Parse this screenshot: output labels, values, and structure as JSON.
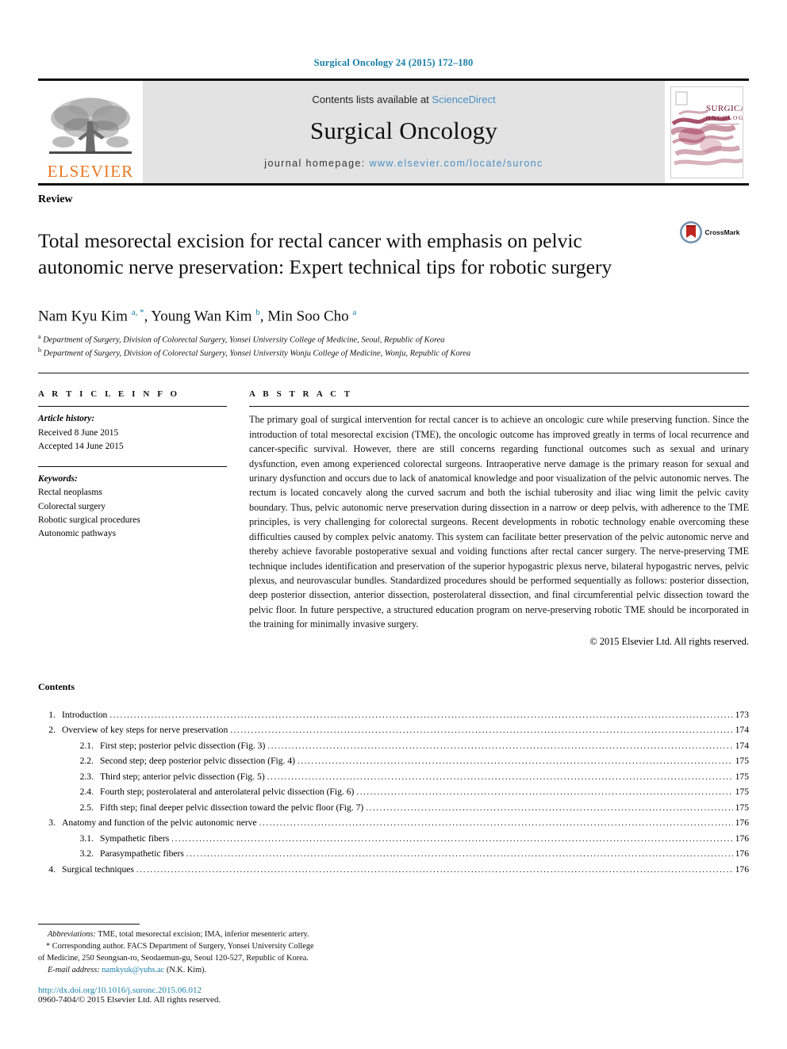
{
  "running_head": "Surgical Oncology 24 (2015) 172–180",
  "masthead": {
    "publisher_wordmark": "ELSEVIER",
    "contents_prefix": "Contents lists available at ",
    "contents_link": "ScienceDirect",
    "journal_name": "Surgical Oncology",
    "homepage_label": "journal homepage: ",
    "homepage_url": "www.elsevier.com/locate/suronc",
    "cover_title_line1": "SURGICAL",
    "cover_title_line2": "ONCOLOGY"
  },
  "article": {
    "section_type": "Review",
    "title": "Total mesorectal excision for rectal cancer with emphasis on pelvic autonomic nerve preservation: Expert technical tips for robotic surgery",
    "crossmark_label": "CrossMark",
    "authors_html": "Nam Kyu Kim <sup>a, *</sup>, Young Wan Kim <sup>b</sup>, Min Soo Cho <sup>a</sup>",
    "affiliations": [
      "Department of Surgery, Division of Colorectal Surgery, Yonsei University College of Medicine, Seoul, Republic of Korea",
      "Department of Surgery, Division of Colorectal Surgery, Yonsei University Wonju College of Medicine, Wonju, Republic of Korea"
    ],
    "affiliation_marks": [
      "a",
      "b"
    ]
  },
  "article_info": {
    "heading": "A R T I C L E  I N F O",
    "history_label": "Article history:",
    "history": [
      "Received 8 June 2015",
      "Accepted 14 June 2015"
    ],
    "keywords_label": "Keywords:",
    "keywords": [
      "Rectal neoplasms",
      "Colorectal surgery",
      "Robotic surgical procedures",
      "Autonomic pathways"
    ]
  },
  "abstract": {
    "heading": "A B S T R A C T",
    "body": "The primary goal of surgical intervention for rectal cancer is to achieve an oncologic cure while preserving function. Since the introduction of total mesorectal excision (TME), the oncologic outcome has improved greatly in terms of local recurrence and cancer-specific survival. However, there are still concerns regarding functional outcomes such as sexual and urinary dysfunction, even among experienced colorectal surgeons. Intraoperative nerve damage is the primary reason for sexual and urinary dysfunction and occurs due to lack of anatomical knowledge and poor visualization of the pelvic autonomic nerves. The rectum is located concavely along the curved sacrum and both the ischial tuberosity and iliac wing limit the pelvic cavity boundary. Thus, pelvic autonomic nerve preservation during dissection in a narrow or deep pelvis, with adherence to the TME principles, is very challenging for colorectal surgeons. Recent developments in robotic technology enable overcoming these difficulties caused by complex pelvic anatomy. This system can facilitate better preservation of the pelvic autonomic nerve and thereby achieve favorable postoperative sexual and voiding functions after rectal cancer surgery. The nerve-preserving TME technique includes identification and preservation of the superior hypogastric plexus nerve, bilateral hypogastric nerves, pelvic plexus, and neurovascular bundles. Standardized procedures should be performed sequentially as follows: posterior dissection, deep posterior dissection, anterior dissection, posterolateral dissection, and final circumferential pelvic dissection toward the pelvic floor. In future perspective, a structured education program on nerve-preserving robotic TME should be incorporated in the training for minimally invasive surgery.",
    "copyright": "© 2015 Elsevier Ltd. All rights reserved."
  },
  "contents": {
    "heading": "Contents",
    "entries": [
      {
        "level": 1,
        "num": "1.",
        "label": "Introduction",
        "page": "173"
      },
      {
        "level": 1,
        "num": "2.",
        "label": "Overview of key steps for nerve preservation",
        "page": "174"
      },
      {
        "level": 2,
        "num": "2.1.",
        "label": "First step; posterior pelvic dissection (Fig. 3)",
        "page": "174"
      },
      {
        "level": 2,
        "num": "2.2.",
        "label": "Second step; deep posterior pelvic dissection (Fig. 4)",
        "page": "175"
      },
      {
        "level": 2,
        "num": "2.3.",
        "label": "Third step; anterior pelvic dissection (Fig. 5)",
        "page": "175"
      },
      {
        "level": 2,
        "num": "2.4.",
        "label": "Fourth step; posterolateral and anterolateral pelvic dissection (Fig. 6)",
        "page": "175"
      },
      {
        "level": 2,
        "num": "2.5.",
        "label": "Fifth step; final deeper pelvic dissection toward the pelvic floor (Fig. 7)",
        "page": "175"
      },
      {
        "level": 1,
        "num": "3.",
        "label": "Anatomy and function of the pelvic autonomic nerve",
        "page": "176"
      },
      {
        "level": 2,
        "num": "3.1.",
        "label": "Sympathetic fibers",
        "page": "176"
      },
      {
        "level": 2,
        "num": "3.2.",
        "label": "Parasympathetic fibers",
        "page": "176"
      },
      {
        "level": 1,
        "num": "4.",
        "label": "Surgical techniques",
        "page": "176"
      }
    ]
  },
  "footnotes": {
    "abbreviations_label": "Abbreviations:",
    "abbreviations_text": " TME, total mesorectal excision; IMA, inferior mesenteric artery.",
    "corresponding_marker": "*",
    "corresponding_line1": " Corresponding author. FACS Department of Surgery, Yonsei University College",
    "corresponding_line2": "of Medicine, 250 Seongsan-ro, Seodaemun-gu, Seoul 120-527, Republic of Korea.",
    "email_label": "E-mail address:",
    "email": "namkyuk@yuhs.ac",
    "email_suffix": " (N.K. Kim)."
  },
  "doi_block": {
    "doi_url": "http://dx.doi.org/10.1016/j.suronc.2015.06.012",
    "issn_line": "0960-7404/© 2015 Elsevier Ltd. All rights reserved."
  },
  "colors": {
    "link_blue": "#1a7fa8",
    "sciencedirect_blue": "#4a90c4",
    "elsevier_orange": "#E87722",
    "masthead_gray": "#e3e3e3",
    "cover_maroon": "#8b1a3a"
  }
}
